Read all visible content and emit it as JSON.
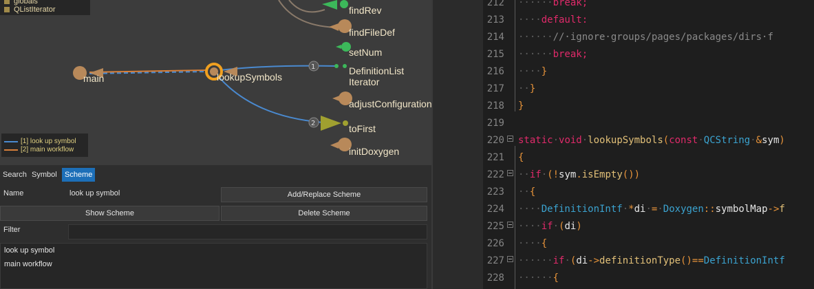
{
  "graph": {
    "legend_top": [
      "globals",
      "QListIterator"
    ],
    "nodes": {
      "main": "main",
      "lookupSymbols": "lookupSymbols",
      "findRev": "findRev",
      "findFileDef": "findFileDef",
      "setNum": "setNum",
      "definitionList_line1": "DefinitionList",
      "definitionList_line2": "Iterator",
      "adjustConfiguration": "adjustConfiguration",
      "toFirst": "toFirst",
      "initDoxygen": "initDoxygen"
    },
    "edge_badges": [
      "1",
      "2"
    ],
    "schemes_legend": [
      {
        "label": "[1]  look up symbol",
        "color": "#4a8ad0"
      },
      {
        "label": "[2]  main workflow",
        "color": "#d8803a"
      }
    ]
  },
  "controls": {
    "tabs": [
      {
        "label": "Search",
        "active": false
      },
      {
        "label": "Symbol",
        "active": false
      },
      {
        "label": "Scheme",
        "active": true
      }
    ],
    "name_label": "Name",
    "name_value": "look up symbol",
    "add_replace_button": "Add/Replace Scheme",
    "show_button": "Show Scheme",
    "delete_button": "Delete Scheme",
    "filter_label": "Filter",
    "filter_value": "",
    "scheme_list": [
      "look up symbol",
      "main workflow"
    ]
  },
  "editor": {
    "line_numbers": [
      "212",
      "213",
      "214",
      "215",
      "216",
      "217",
      "218",
      "219",
      "220",
      "221",
      "222",
      "223",
      "224",
      "225",
      "226",
      "227",
      "228"
    ],
    "lines": [
      [
        {
          "t": "······",
          "c": "ws"
        },
        {
          "t": "break;",
          "c": "kw"
        }
      ],
      [
        {
          "t": "····",
          "c": "ws"
        },
        {
          "t": "default:",
          "c": "kw"
        }
      ],
      [
        {
          "t": "······",
          "c": "ws"
        },
        {
          "t": "//·ignore·groups/pages/packages/dirs·f",
          "c": "cm"
        }
      ],
      [
        {
          "t": "······",
          "c": "ws"
        },
        {
          "t": "break;",
          "c": "kw"
        }
      ],
      [
        {
          "t": "····",
          "c": "ws"
        },
        {
          "t": "}",
          "c": "pn"
        }
      ],
      [
        {
          "t": "··",
          "c": "ws"
        },
        {
          "t": "}",
          "c": "pn"
        }
      ],
      [
        {
          "t": "}",
          "c": "pn"
        }
      ],
      [
        {
          "t": "",
          "c": "tx"
        }
      ],
      [
        {
          "t": "static",
          "c": "kw"
        },
        {
          "t": "·",
          "c": "ws"
        },
        {
          "t": "void",
          "c": "kw"
        },
        {
          "t": "·",
          "c": "ws"
        },
        {
          "t": "lookupSymbols",
          "c": "fn"
        },
        {
          "t": "(",
          "c": "pn"
        },
        {
          "t": "const",
          "c": "kw"
        },
        {
          "t": "·",
          "c": "ws"
        },
        {
          "t": "QCString",
          "c": "ty"
        },
        {
          "t": "·",
          "c": "ws"
        },
        {
          "t": "&",
          "c": "pn"
        },
        {
          "t": "sym",
          "c": "tx"
        },
        {
          "t": ")",
          "c": "pn"
        }
      ],
      [
        {
          "t": "{",
          "c": "pn"
        }
      ],
      [
        {
          "t": "··",
          "c": "ws"
        },
        {
          "t": "if",
          "c": "kw"
        },
        {
          "t": "·",
          "c": "ws"
        },
        {
          "t": "(!",
          "c": "pn"
        },
        {
          "t": "sym",
          "c": "tx"
        },
        {
          "t": ".",
          "c": "pn"
        },
        {
          "t": "isEmpty",
          "c": "fn"
        },
        {
          "t": "())",
          "c": "pn"
        }
      ],
      [
        {
          "t": "··",
          "c": "ws"
        },
        {
          "t": "{",
          "c": "pn"
        }
      ],
      [
        {
          "t": "····",
          "c": "ws"
        },
        {
          "t": "DefinitionIntf",
          "c": "ty"
        },
        {
          "t": "·",
          "c": "ws"
        },
        {
          "t": "*",
          "c": "pn"
        },
        {
          "t": "di",
          "c": "tx"
        },
        {
          "t": "·",
          "c": "ws"
        },
        {
          "t": "=",
          "c": "pn"
        },
        {
          "t": "·",
          "c": "ws"
        },
        {
          "t": "Doxygen",
          "c": "ty"
        },
        {
          "t": "::",
          "c": "pn"
        },
        {
          "t": "symbolMap",
          "c": "tx"
        },
        {
          "t": "->",
          "c": "pn"
        },
        {
          "t": "f",
          "c": "fn"
        }
      ],
      [
        {
          "t": "····",
          "c": "ws"
        },
        {
          "t": "if",
          "c": "kw"
        },
        {
          "t": "·",
          "c": "ws"
        },
        {
          "t": "(",
          "c": "pn"
        },
        {
          "t": "di",
          "c": "tx"
        },
        {
          "t": ")",
          "c": "pn"
        }
      ],
      [
        {
          "t": "····",
          "c": "ws"
        },
        {
          "t": "{",
          "c": "pn"
        }
      ],
      [
        {
          "t": "······",
          "c": "ws"
        },
        {
          "t": "if",
          "c": "kw"
        },
        {
          "t": "·",
          "c": "ws"
        },
        {
          "t": "(",
          "c": "pn"
        },
        {
          "t": "di",
          "c": "tx"
        },
        {
          "t": "->",
          "c": "pn"
        },
        {
          "t": "definitionType",
          "c": "fn"
        },
        {
          "t": "()==",
          "c": "pn"
        },
        {
          "t": "DefinitionInt",
          "c": "ty"
        },
        {
          "t": "f",
          "c": "ty"
        }
      ],
      [
        {
          "t": "······",
          "c": "ws"
        },
        {
          "t": "{",
          "c": "pn"
        }
      ]
    ]
  }
}
